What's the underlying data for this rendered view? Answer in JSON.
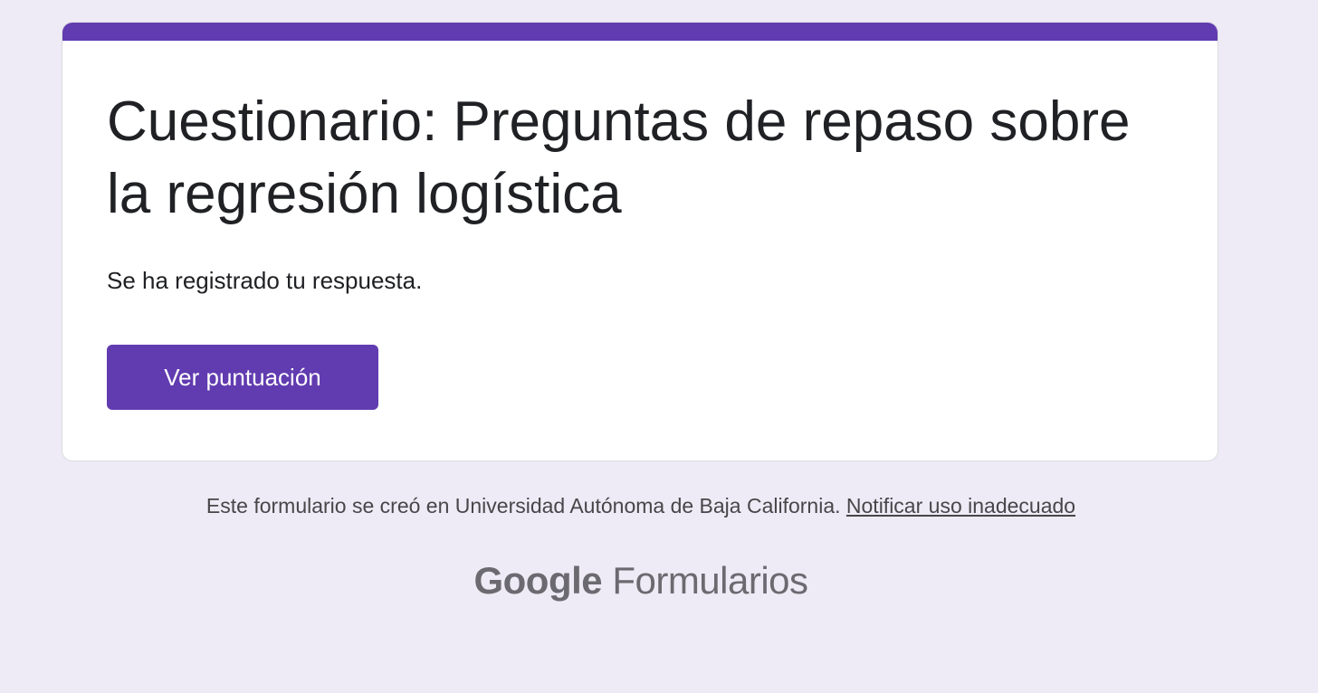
{
  "colors": {
    "page_background": "#efebf6",
    "accent": "#613bb0",
    "card_background": "#ffffff",
    "text_primary": "#202124",
    "footer_text": "#474649",
    "brand_gray": "#6b6a70"
  },
  "form": {
    "title": "Cuestionario: Preguntas de repaso sobre la regresión logística",
    "confirmation_message": "Se ha registrado tu respuesta.",
    "view_score_label": "Ver puntuación"
  },
  "footer": {
    "note": "Este formulario se creó en Universidad Autónoma de Baja California.",
    "report_link": "Notificar uso inadecuado"
  },
  "brand": {
    "google": "Google",
    "product": "Formularios"
  }
}
